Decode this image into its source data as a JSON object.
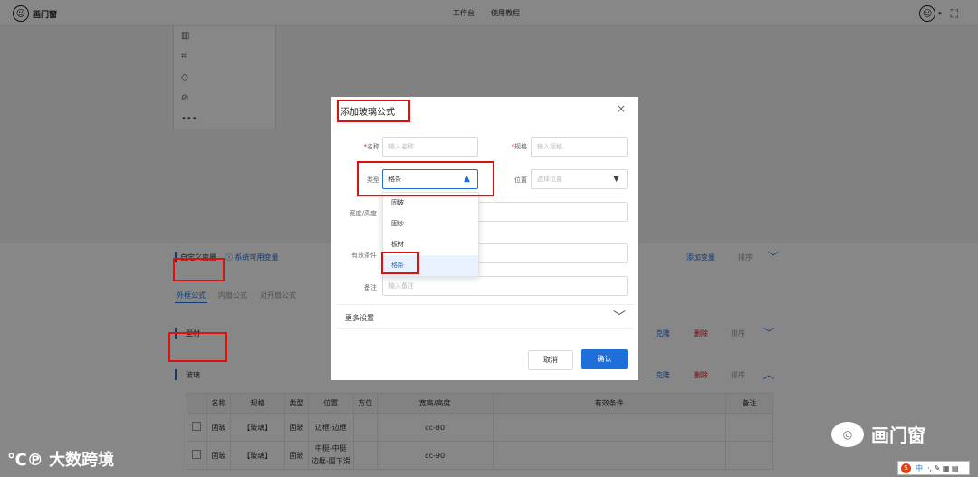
{
  "topbar": {
    "logo_glyph": "☺",
    "app_name": "画门窗",
    "nav": [
      "工作台",
      "使用教程"
    ],
    "user_glyph": "☺",
    "caret": "▾",
    "fullscreen": "⛶"
  },
  "tools": [
    "▥",
    "⌗",
    "◇",
    "⊘",
    "•••"
  ],
  "variables": {
    "label": "自定义变量",
    "system_link": "ⓘ 系统可用变量",
    "add": "添加变量",
    "sort": "排序",
    "chevron": "﹀"
  },
  "tabs": [
    "外框公式",
    "内扇公式",
    "对开扇公式"
  ],
  "sections": [
    {
      "label": "型材",
      "actions": [
        "克隆",
        "删除",
        "排序"
      ],
      "chevron": "﹀"
    },
    {
      "label": "玻璃",
      "actions": [
        "克隆",
        "删除",
        "排序"
      ],
      "chevron": "︿"
    }
  ],
  "table": {
    "headers": [
      "",
      "名称",
      "规格",
      "类型",
      "位置",
      "方位",
      "宽高/高度",
      "有效条件",
      "备注"
    ],
    "rows": [
      [
        "",
        "固玻",
        "【玻璃】",
        "固玻",
        "边框-边框",
        "",
        "cc-80",
        "",
        ""
      ],
      [
        "",
        "固玻",
        "【玻璃】",
        "固玻",
        "中梃-中梃\n边框-固下滑",
        "",
        "cc-90",
        "",
        ""
      ]
    ]
  },
  "modal": {
    "title": "添加玻璃公式",
    "close": "×",
    "fields": {
      "name_label": "名称",
      "name_placeholder": "输入名称",
      "spec_label": "规格",
      "spec_placeholder": "输入规格",
      "type_label": "类型",
      "type_value": "格条",
      "type_arrow": "▲",
      "position_label": "位置",
      "position_placeholder": "选择位置",
      "position_arrow": "▼",
      "size_label": "宽度/高度",
      "condition_label": "有效条件",
      "remark_label": "备注",
      "remark_placeholder": "输入备注",
      "required_mark": "*"
    },
    "type_options": [
      "固玻",
      "固纱",
      "板材",
      "格条"
    ],
    "selected_option": "格条",
    "more_settings": "更多设置",
    "more_chevron": "﹀",
    "cancel": "取消",
    "confirm": "确认"
  },
  "watermark": {
    "left": "℃℗ 大数跨境",
    "right_icon": "◎",
    "right_text": "画门窗"
  },
  "ime": {
    "s": "S",
    "zh": "中",
    "icons": "·, ✎ ▦ ▤"
  },
  "colors": {
    "accent": "#1e6fd9",
    "danger": "#e01010",
    "highlight_box": "#e01010"
  }
}
